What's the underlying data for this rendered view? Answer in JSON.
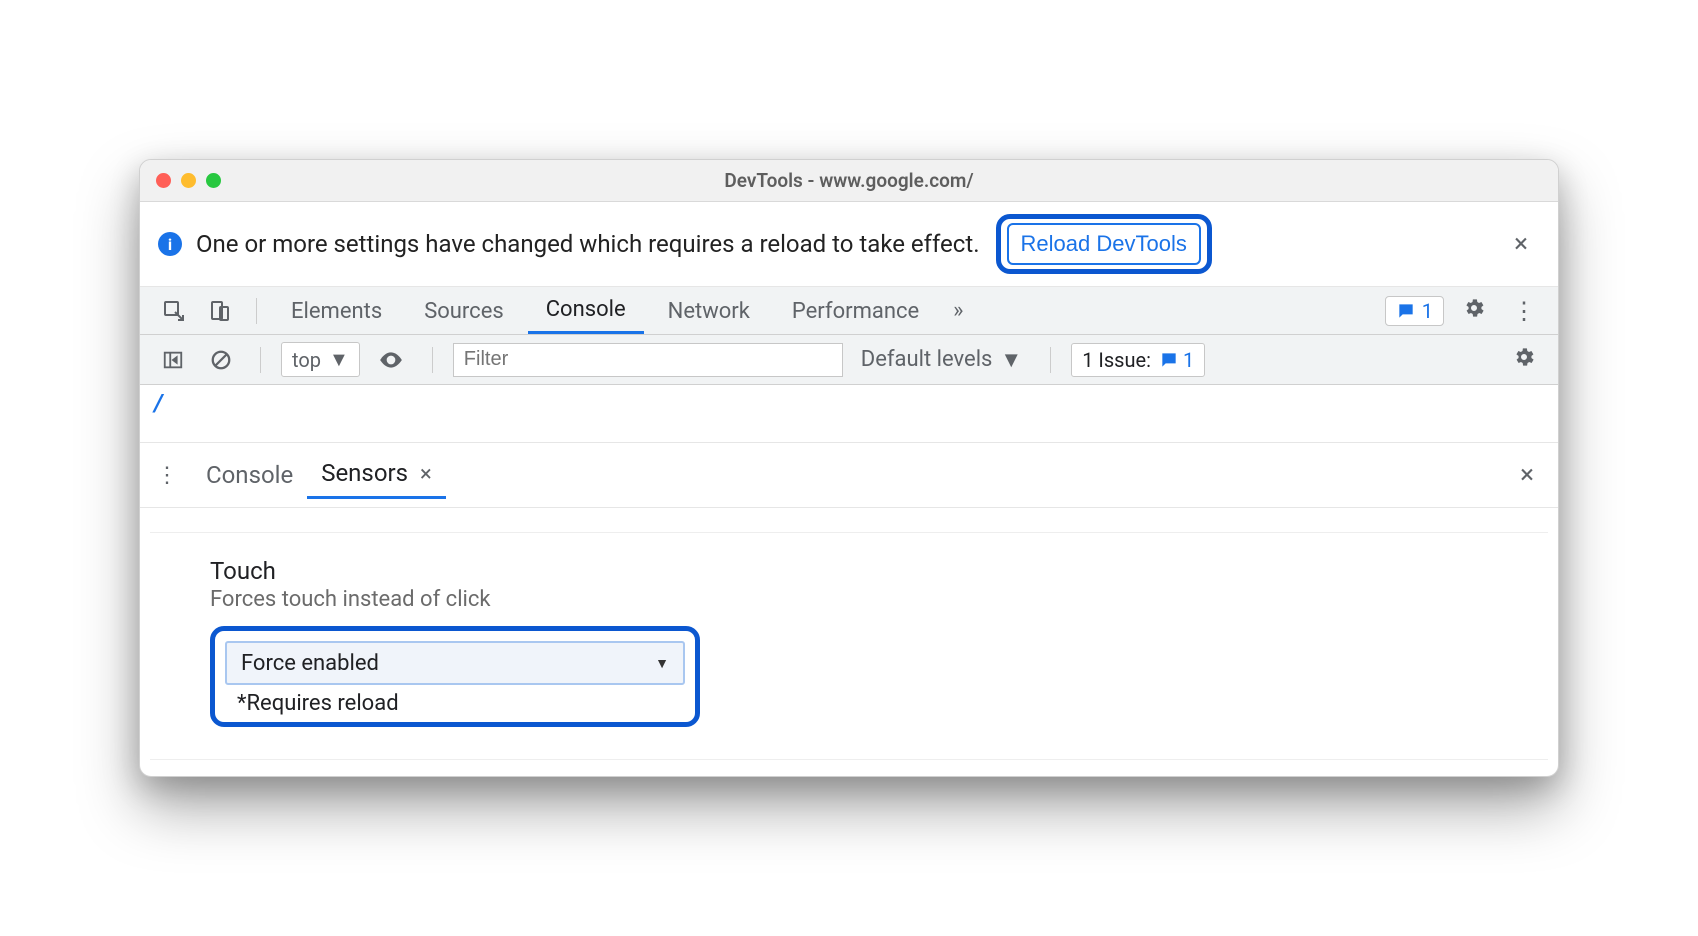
{
  "window": {
    "title": "DevTools - www.google.com/"
  },
  "banner": {
    "message": "One or more settings have changed which requires a reload to take effect.",
    "button": "Reload DevTools",
    "close_glyph": "×"
  },
  "tabs": {
    "items": [
      "Elements",
      "Sources",
      "Console",
      "Network",
      "Performance"
    ],
    "active_index": 2,
    "overflow_glyph": "»",
    "msg_count": "1"
  },
  "console_toolbar": {
    "context": "top",
    "filter_placeholder": "Filter",
    "levels_label": "Default levels",
    "issue_label": "1 Issue:",
    "issue_count": "1"
  },
  "drawer": {
    "tabs": [
      "Console",
      "Sensors"
    ],
    "active_index": 1,
    "close_glyph": "×"
  },
  "sensors": {
    "title": "Touch",
    "subtitle": "Forces touch instead of click",
    "selected": "Force enabled",
    "note": "*Requires reload"
  }
}
